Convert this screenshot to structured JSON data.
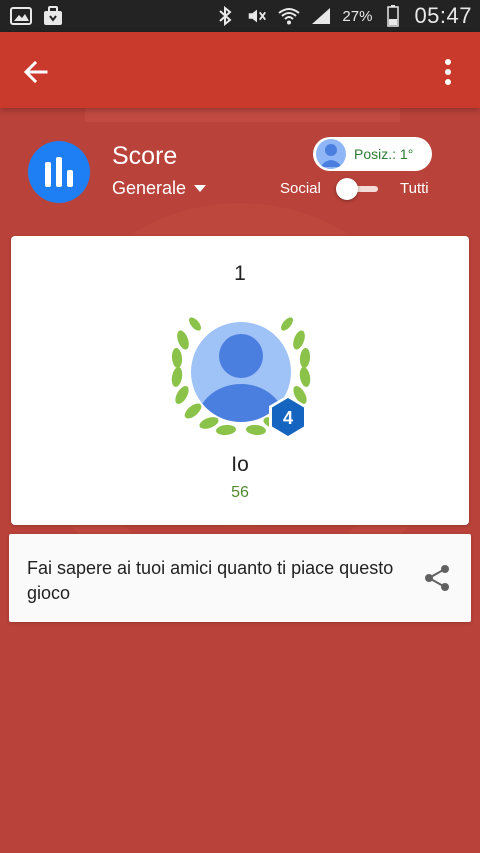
{
  "status_bar": {
    "battery": "27%",
    "time": "05:47",
    "icons": [
      "gallery-icon",
      "bag-icon",
      "bluetooth-icon",
      "mute-icon",
      "wifi-icon",
      "signal-icon",
      "battery-icon"
    ]
  },
  "app_bar": {
    "icons": [
      "back-arrow-icon",
      "more-vert-icon"
    ]
  },
  "header": {
    "title": "Score",
    "filter": "Generale",
    "position": "Posiz.: 1°",
    "toggle_left": "Social",
    "toggle_right": "Tutti",
    "toggle_on": true
  },
  "rank_card": {
    "rank": "1",
    "player_name": "Io",
    "points": "56",
    "level": "4"
  },
  "share_card": {
    "text": "Fai sapere ai tuoi amici quanto ti piace questo gioco",
    "icon": "share-icon"
  },
  "colors": {
    "status_bar": "#232323",
    "app_bar": "#c9392c",
    "background": "#b9423a",
    "score_icon": "#1e7ff5",
    "points": "#4e8a2e",
    "level_badge": "#1565c0",
    "laurel": "#8bc34a"
  }
}
